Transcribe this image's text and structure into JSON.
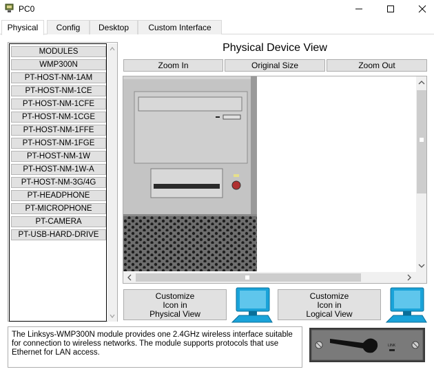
{
  "window": {
    "title": "PC0",
    "icon": "packet-tracer-pc-icon",
    "controls": [
      "minimize-icon",
      "maximize-icon",
      "close-icon"
    ]
  },
  "tabs": [
    {
      "label": "Physical",
      "active": true
    },
    {
      "label": "Config",
      "active": false
    },
    {
      "label": "Desktop",
      "active": false
    },
    {
      "label": "Custom Interface",
      "active": false
    }
  ],
  "modules": {
    "items": [
      "MODULES",
      "WMP300N",
      "PT-HOST-NM-1AM",
      "PT-HOST-NM-1CE",
      "PT-HOST-NM-1CFE",
      "PT-HOST-NM-1CGE",
      "PT-HOST-NM-1FFE",
      "PT-HOST-NM-1FGE",
      "PT-HOST-NM-1W",
      "PT-HOST-NM-1W-A",
      "PT-HOST-NM-3G/4G",
      "PT-HEADPHONE",
      "PT-MICROPHONE",
      "PT-CAMERA",
      "PT-USB-HARD-DRIVE"
    ]
  },
  "physical_view": {
    "title": "Physical Device View",
    "zoom_in": "Zoom In",
    "original_size": "Original Size",
    "zoom_out": "Zoom Out"
  },
  "customize": {
    "physical": [
      "Customize",
      "Icon in",
      "Physical View"
    ],
    "logical": [
      "Customize",
      "Icon in",
      "Logical View"
    ]
  },
  "description": "The Linksys-WMP300N module provides one 2.4GHz wireless interface suitable for connection to wireless networks. The module supports protocols that use Ethernet for LAN access.",
  "module_image_label": "LINK",
  "colors": {
    "button_face": "#e1e1e1",
    "border": "#adadad",
    "pc_case": "#c8c8c8",
    "power_led": "#b03030",
    "monitor_blue": "#1aa3d9"
  }
}
